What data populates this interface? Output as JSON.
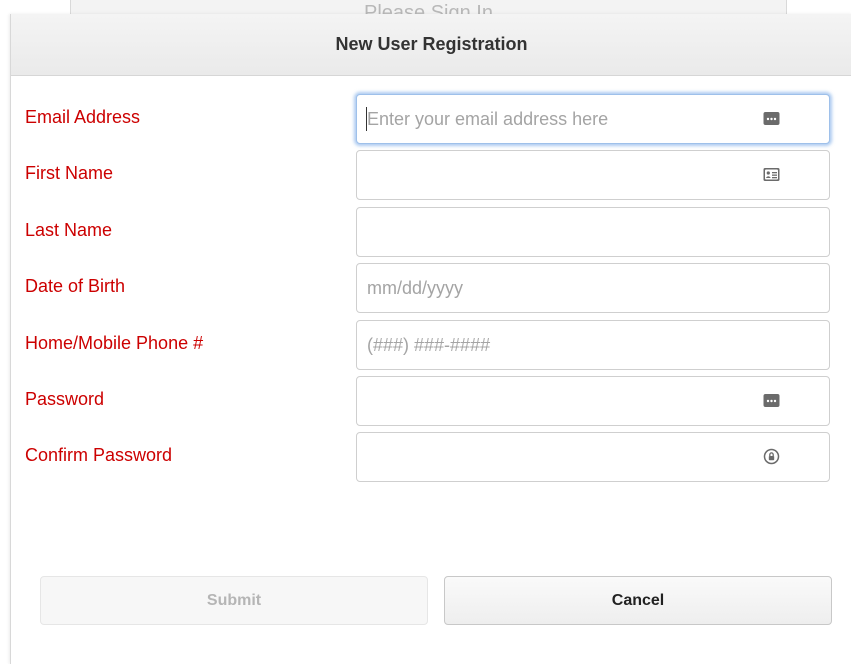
{
  "background": {
    "behind_title": "Please Sign In"
  },
  "modal": {
    "title": "New User Registration"
  },
  "form": {
    "fields": [
      {
        "label": "Email Address",
        "value": "",
        "placeholder": "Enter your email address here",
        "icon": "keychain-autofill-icon",
        "focused": true
      },
      {
        "label": "First Name",
        "value": "",
        "placeholder": "",
        "icon": "contact-card-icon"
      },
      {
        "label": "Last Name",
        "value": "",
        "placeholder": "",
        "icon": ""
      },
      {
        "label": "Date of Birth",
        "value": "",
        "placeholder": "mm/dd/yyyy",
        "icon": ""
      },
      {
        "label": "Home/Mobile Phone #",
        "value": "",
        "placeholder": "(###) ###-####",
        "icon": ""
      },
      {
        "label": "Password",
        "value": "",
        "placeholder": "",
        "icon": "keychain-autofill-icon"
      },
      {
        "label": "Confirm Password",
        "value": "",
        "placeholder": "",
        "icon": "password-key-icon"
      }
    ]
  },
  "buttons": {
    "submit_label": "Submit",
    "submit_disabled": true,
    "cancel_label": "Cancel"
  },
  "colors": {
    "label": "#cc0000",
    "focus_ring": "#689ee4",
    "header_bg": "#eeeeee"
  }
}
